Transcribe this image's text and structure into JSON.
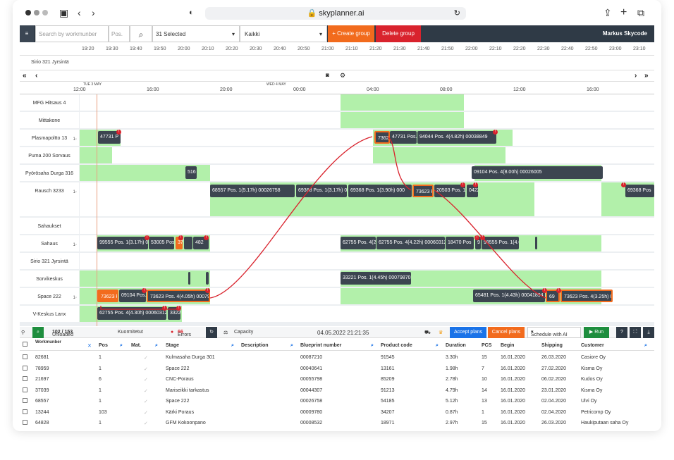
{
  "browser": {
    "url": "skyplanner.ai"
  },
  "topbar": {
    "search_placeholder": "Search by workmunber",
    "pos_placeholder": "Pos.",
    "selected": "31 Selected",
    "filter": "Kaikki",
    "create_group": "+ Create group",
    "delete_group": "Delete group",
    "user": "Markus Skycode"
  },
  "ruler": [
    "19:20",
    "19:30",
    "19:40",
    "19:50",
    "20:00",
    "20:10",
    "20:20",
    "20:30",
    "20:40",
    "20:50",
    "21:00",
    "21:10",
    "21:20",
    "21:30",
    "21:40",
    "21:50",
    "22:00",
    "22:10",
    "22:20",
    "22:30",
    "22:40",
    "22:50",
    "23:00",
    "23:10"
  ],
  "mini_label": "Sirio 321 Jyrsintä",
  "timeline": {
    "day1": "TUE 3 MAY",
    "day2": "WED 4 MAY",
    "hours": [
      "12:00",
      "16:00",
      "20:00",
      "00:00",
      "04:00",
      "08:00",
      "12:00",
      "16:00"
    ]
  },
  "rows": [
    "MFG Hitsaus 4",
    "Mittakone",
    "Plasmapoltto 13",
    "Puma 200 Sorvaus",
    "Pyörösaha Durga 316",
    "Rausch 3233",
    "Sahaukset",
    "Sahaus",
    "Sirio 321 Jyrsintä",
    "Sorvikeskus",
    "Space 222",
    "V-Keskus Lanx"
  ],
  "jobs": {
    "j1": "47731 P",
    "j2": "73623",
    "j3": "47731 Pos.",
    "j4": "94044 Pos. 4(4.82h) 00038849",
    "j5": "516",
    "j6": "09104 Pos. 4(8.00h) 00026005",
    "j7": "68557 Pos. 1(5.17h) 00026758",
    "j8": "69368 Pos. 1(3.17h) 00",
    "j9": "69368 Pos. 1(3.90h) 000",
    "j10": "73623 Pos",
    "j11": "20503 Pos. 1(",
    "j12": "0422",
    "j13": "69368 Pos",
    "j14": "99555 Pos. 1(3.17h) 00",
    "j15": "53005 Pos",
    "j16": "37",
    "j17": "482",
    "j18": "62755 Pos. 4(2",
    "j19": "62755 Pos. 4(4.22h) 00060312",
    "j20": "18470 Pos",
    "j21": "9",
    "j22": "99555 Pos. 1(4.04h) 0004C",
    "j23": "33221 Pos. 1(4.45h) 00079870",
    "j24": "73623 P",
    "j25": "09104 Pos.",
    "j26": "73623 Pos. 4(4.05h) 00079",
    "j27": "65481 Pos. 1(4.43h) 00041894",
    "j28": "69",
    "j29": "73623 Pos. 4(3.25h) 00",
    "j30": "62755 Pos. 4(4.30h) 00060312",
    "j31": "3322"
  },
  "toolbar": {
    "unloaded": "Unloaded",
    "unloaded_count": "102 / 153",
    "kuormitetut": "Kuormitetut",
    "errors": "Errors",
    "errors_count": "66",
    "capacity": "Capacity",
    "datetime": "04.05.2022 21:21:35",
    "accept": "Accept plans",
    "cancel": "Cancel plans",
    "schedule": "Schedule with AI",
    "run": "▶ Run"
  },
  "columns": [
    "Workmunber",
    "Pos",
    "Mat.",
    "Stage",
    "Description",
    "Blueprint number",
    "Product code",
    "Duration",
    "PCS",
    "Begin",
    "Shipping",
    "Customer"
  ],
  "table": [
    [
      "82681",
      "1",
      "",
      "Kulmasaha Durga 301",
      "",
      "00087210",
      "91545",
      "3.30h",
      "15",
      "16.01.2020",
      "26.03.2020",
      "Casiore Oy"
    ],
    [
      "78959",
      "1",
      "",
      "Space 222",
      "",
      "00040641",
      "13161",
      "1.98h",
      "7",
      "16.01.2020",
      "27.02.2020",
      "Kisma Oy"
    ],
    [
      "21697",
      "6",
      "",
      "CNC-Poraus",
      "",
      "00055798",
      "85209",
      "2.78h",
      "10",
      "16.01.2020",
      "06.02.2020",
      "Kudos Oy"
    ],
    [
      "37039",
      "1",
      "",
      "Mariseikki tarkastus",
      "",
      "00044307",
      "91213",
      "4.79h",
      "14",
      "16.01.2020",
      "23.01.2020",
      "Kisma Oy"
    ],
    [
      "68557",
      "1",
      "",
      "Space 222",
      "",
      "00026758",
      "54185",
      "5.12h",
      "13",
      "16.01.2020",
      "02.04.2020",
      "Ulvi Oy"
    ],
    [
      "13244",
      "103",
      "",
      "Kärki Poraus",
      "",
      "00009780",
      "34207",
      "0.87h",
      "1",
      "16.01.2020",
      "02.04.2020",
      "Petricomp Oy"
    ],
    [
      "64828",
      "1",
      "",
      "GFM Kokoonpano",
      "",
      "00008532",
      "18971",
      "2.97h",
      "15",
      "16.01.2020",
      "26.03.2020",
      "Haukiputaan saha Oy"
    ]
  ]
}
